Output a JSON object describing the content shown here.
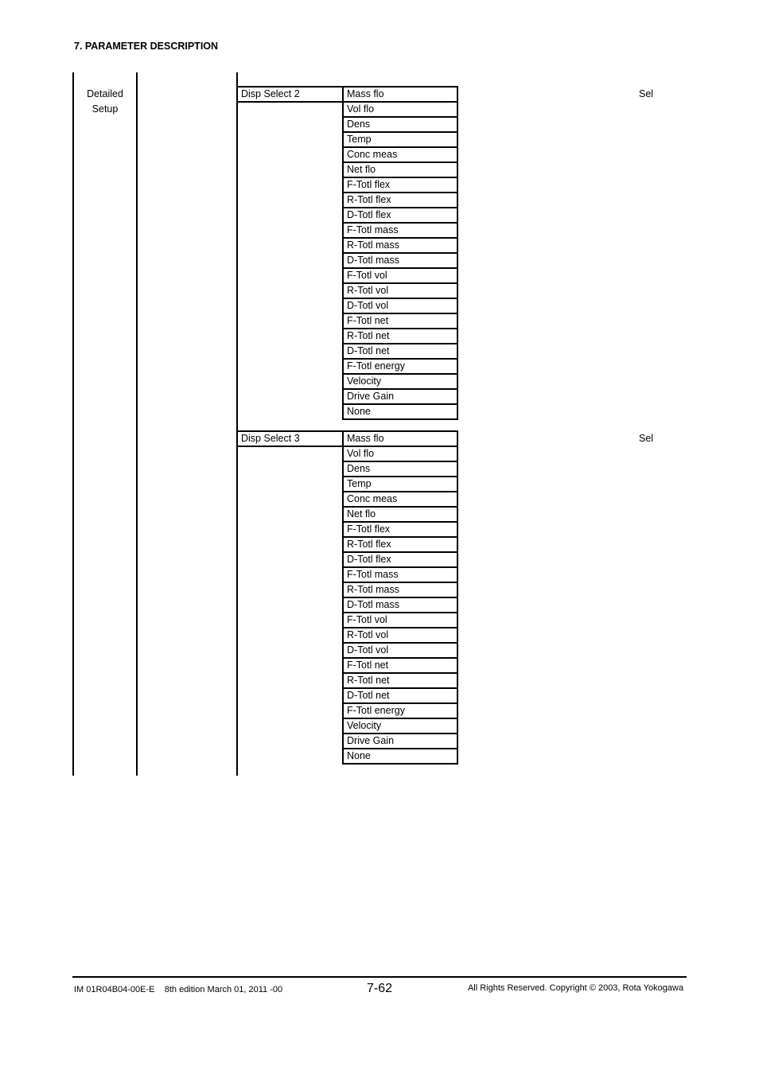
{
  "header": {
    "section_title": "7. PARAMETER DESCRIPTION"
  },
  "tree": {
    "level1_label": "Detailed\nSetup",
    "level1_lines": [
      "Detailed",
      "Setup"
    ],
    "parameters": [
      {
        "name": "Disp Select 2",
        "column_note": "Sel",
        "options": [
          "Mass flo",
          "Vol flo",
          "Dens",
          "Temp",
          "Conc meas",
          "Net flo",
          "F-Totl flex",
          "R-Totl flex",
          "D-Totl flex",
          "F-Totl mass",
          "R-Totl mass",
          "D-Totl mass",
          "F-Totl vol",
          "R-Totl vol",
          "D-Totl vol",
          "F-Totl net",
          "R-Totl net",
          "D-Totl net",
          "F-Totl energy",
          "Velocity",
          "Drive Gain",
          "None"
        ]
      },
      {
        "name": "Disp Select 3",
        "column_note": "Sel",
        "options": [
          "Mass flo",
          "Vol flo",
          "Dens",
          "Temp",
          "Conc meas",
          "Net flo",
          "F-Totl flex",
          "R-Totl flex",
          "D-Totl flex",
          "F-Totl mass",
          "R-Totl mass",
          "D-Totl mass",
          "F-Totl vol",
          "R-Totl vol",
          "D-Totl vol",
          "F-Totl net",
          "R-Totl net",
          "D-Totl net",
          "F-Totl energy",
          "Velocity",
          "Drive Gain",
          "None"
        ]
      }
    ]
  },
  "footer": {
    "doc_id": "IM 01R04B04-00E-E    8th edition March 01, 2011 -00",
    "page_number": "7-62",
    "copyright": "All Rights Reserved. Copyright © 2003, Rota Yokogawa"
  }
}
